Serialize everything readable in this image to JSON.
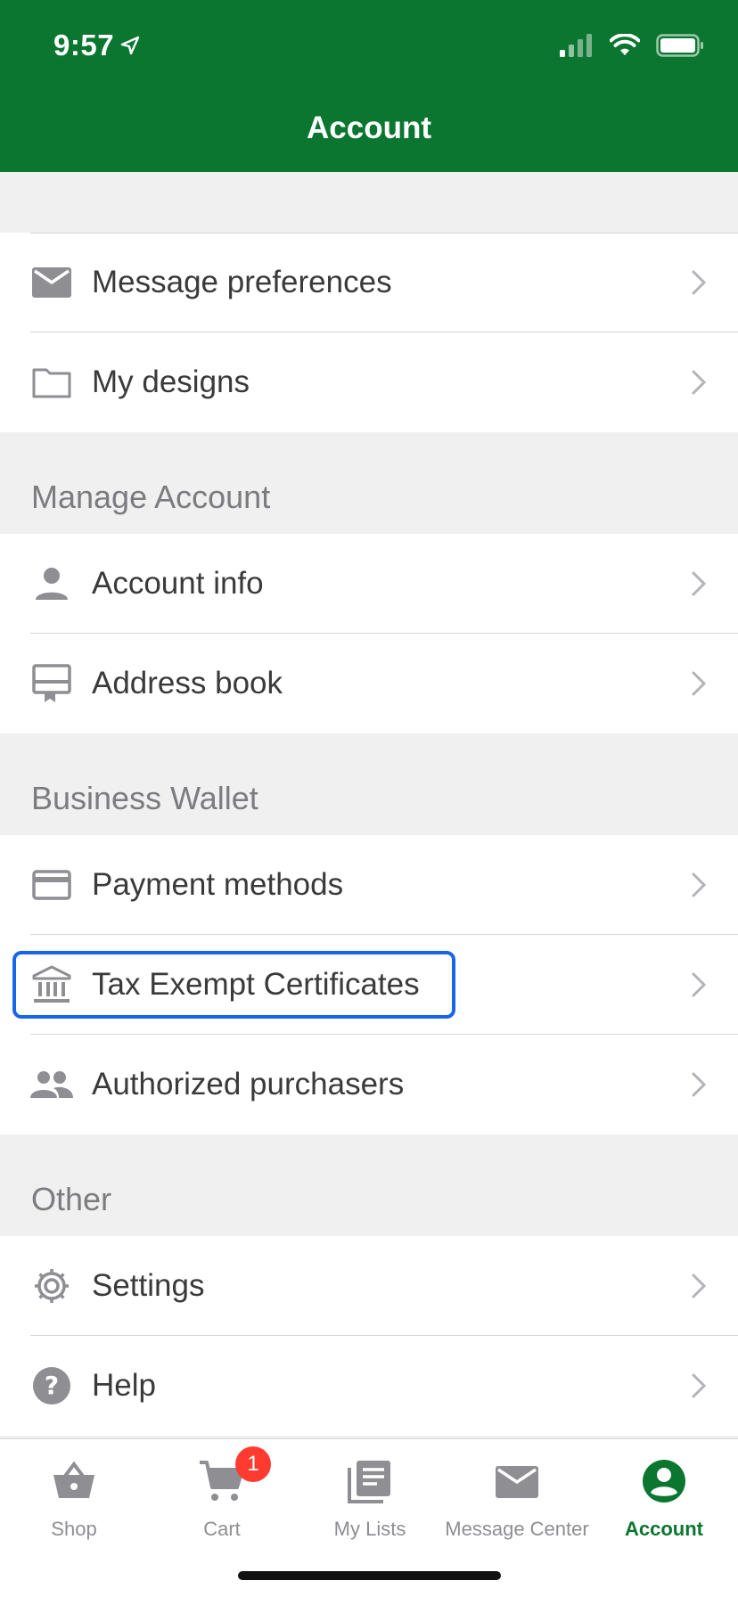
{
  "status_bar": {
    "time": "9:57"
  },
  "header": {
    "title": "Account"
  },
  "sections": {
    "top": {
      "items": [
        {
          "label": "Message preferences",
          "icon": "envelope-icon"
        },
        {
          "label": "My designs",
          "icon": "folder-icon"
        }
      ]
    },
    "manage_account": {
      "title": "Manage Account",
      "items": [
        {
          "label": "Account info",
          "icon": "person-icon"
        },
        {
          "label": "Address book",
          "icon": "address-book-icon"
        }
      ]
    },
    "business_wallet": {
      "title": "Business Wallet",
      "items": [
        {
          "label": "Payment methods",
          "icon": "credit-card-icon"
        },
        {
          "label": "Tax Exempt Certificates",
          "icon": "bank-icon",
          "focused": true
        },
        {
          "label": "Authorized purchasers",
          "icon": "people-icon"
        }
      ]
    },
    "other": {
      "title": "Other",
      "items": [
        {
          "label": "Settings",
          "icon": "gear-icon"
        },
        {
          "label": "Help",
          "icon": "question-icon"
        }
      ]
    }
  },
  "tabbar": {
    "tabs": [
      {
        "label": "Shop",
        "icon": "basket-icon"
      },
      {
        "label": "Cart",
        "icon": "cart-icon",
        "badge": "1"
      },
      {
        "label": "My Lists",
        "icon": "list-icon"
      },
      {
        "label": "Message Center",
        "icon": "envelope-icon"
      },
      {
        "label": "Account",
        "icon": "account-icon",
        "active": true
      }
    ]
  },
  "colors": {
    "brand_green": "#0b7630",
    "focus_blue": "#1766e8",
    "badge_red": "#ff3b30",
    "icon_gray": "#8e8e93"
  }
}
